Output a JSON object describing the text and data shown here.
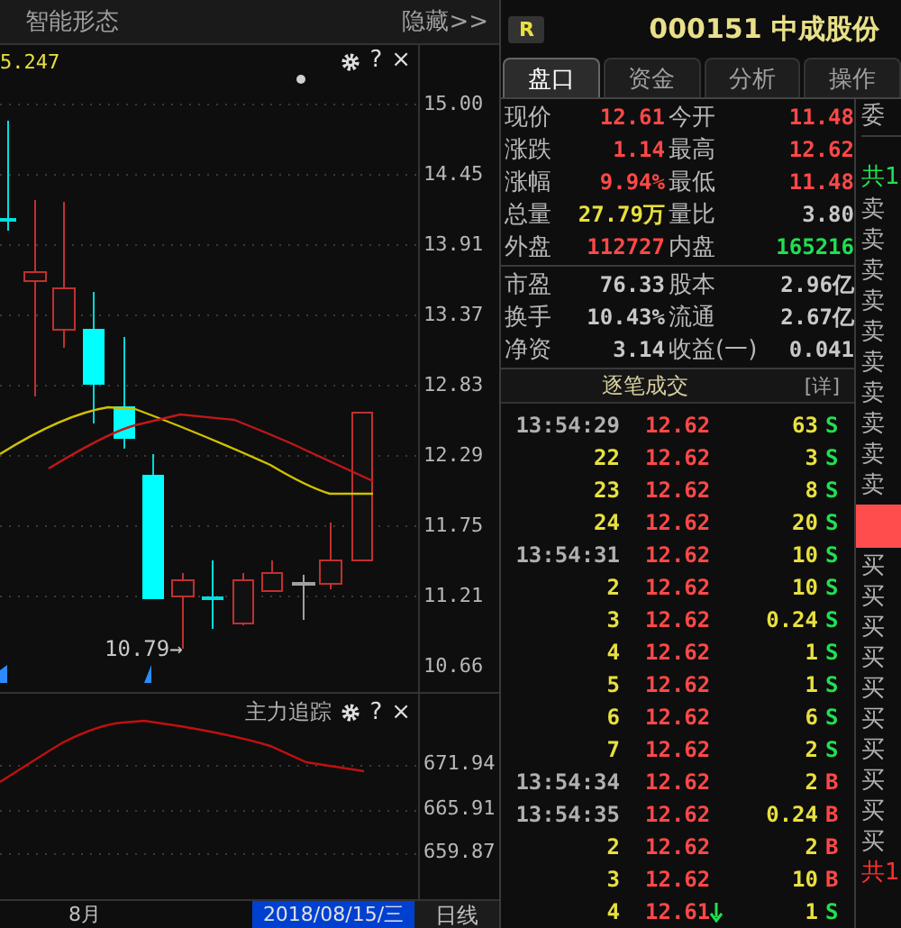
{
  "left_panel": {
    "title": "智能形态",
    "hide_button": "隐藏>>"
  },
  "main_chart": {
    "indicator_value": "5.247",
    "help": "?",
    "close": "×",
    "price_axis": [
      "15.00",
      "14.45",
      "13.91",
      "13.37",
      "12.83",
      "12.29",
      "11.75",
      "11.21",
      "10.66"
    ],
    "low_label": "10.79→"
  },
  "sub_chart": {
    "title": "主力追踪",
    "help": "?",
    "close": "×",
    "axis": [
      "671.94",
      "665.91",
      "659.87"
    ]
  },
  "bottom_bar": {
    "month": "8月",
    "cursor_date": "2018/08/15/三",
    "period": "日线"
  },
  "stock": {
    "badge": "R",
    "code_name": "000151 中成股份"
  },
  "tabs": [
    {
      "label": "盘口",
      "selected": true
    },
    {
      "label": "资金",
      "selected": false
    },
    {
      "label": "分析",
      "selected": false
    },
    {
      "label": "操作",
      "selected": false
    }
  ],
  "quote_groups": [
    [
      {
        "cells": [
          {
            "label": "现价",
            "value": "12.61",
            "kind": "up"
          },
          {
            "label": "今开",
            "value": "11.48",
            "kind": "up"
          }
        ]
      },
      {
        "cells": [
          {
            "label": "涨跌",
            "value": "1.14",
            "kind": "up"
          },
          {
            "label": "最高",
            "value": "12.62",
            "kind": "up"
          }
        ]
      },
      {
        "cells": [
          {
            "label": "涨幅",
            "value": "9.94%",
            "kind": "up"
          },
          {
            "label": "最低",
            "value": "11.48",
            "kind": "up"
          }
        ]
      },
      {
        "cells": [
          {
            "label": "总量",
            "value": "27.79万",
            "kind": "volume"
          },
          {
            "label": "量比",
            "value": "3.80",
            "kind": "flat"
          }
        ]
      },
      {
        "cells": [
          {
            "label": "外盘",
            "value": "112727",
            "kind": "up"
          },
          {
            "label": "内盘",
            "value": "165216",
            "kind": "down"
          }
        ]
      }
    ],
    [
      {
        "cells": [
          {
            "label": "市盈",
            "value": "76.33",
            "kind": "flat"
          },
          {
            "label": "股本",
            "value": "2.96亿",
            "kind": "flat"
          }
        ]
      },
      {
        "cells": [
          {
            "label": "换手",
            "value": "10.43%",
            "kind": "flat"
          },
          {
            "label": "流通",
            "value": "2.67亿",
            "kind": "flat"
          }
        ]
      },
      {
        "cells": [
          {
            "label": "净资",
            "value": "3.14",
            "kind": "flat"
          },
          {
            "label": "收益(一)",
            "value": "0.041",
            "kind": "flat"
          }
        ]
      }
    ]
  ],
  "trades_header": {
    "title": "逐笔成交",
    "detail": "[详]"
  },
  "trades": [
    {
      "time": "13:54:29",
      "full_time": true,
      "price": "12.62",
      "down_tick": false,
      "volume": "63",
      "side": "S",
      "buy": false
    },
    {
      "time": "22",
      "full_time": false,
      "price": "12.62",
      "down_tick": false,
      "volume": "3",
      "side": "S",
      "buy": false
    },
    {
      "time": "23",
      "full_time": false,
      "price": "12.62",
      "down_tick": false,
      "volume": "8",
      "side": "S",
      "buy": false
    },
    {
      "time": "24",
      "full_time": false,
      "price": "12.62",
      "down_tick": false,
      "volume": "20",
      "side": "S",
      "buy": false
    },
    {
      "time": "13:54:31",
      "full_time": true,
      "price": "12.62",
      "down_tick": false,
      "volume": "10",
      "side": "S",
      "buy": false
    },
    {
      "time": "2",
      "full_time": false,
      "price": "12.62",
      "down_tick": false,
      "volume": "10",
      "side": "S",
      "buy": false
    },
    {
      "time": "3",
      "full_time": false,
      "price": "12.62",
      "down_tick": false,
      "volume": "0.24",
      "side": "S",
      "buy": false
    },
    {
      "time": "4",
      "full_time": false,
      "price": "12.62",
      "down_tick": false,
      "volume": "1",
      "side": "S",
      "buy": false
    },
    {
      "time": "5",
      "full_time": false,
      "price": "12.62",
      "down_tick": false,
      "volume": "1",
      "side": "S",
      "buy": false
    },
    {
      "time": "6",
      "full_time": false,
      "price": "12.62",
      "down_tick": false,
      "volume": "6",
      "side": "S",
      "buy": false
    },
    {
      "time": "7",
      "full_time": false,
      "price": "12.62",
      "down_tick": false,
      "volume": "2",
      "side": "S",
      "buy": false
    },
    {
      "time": "13:54:34",
      "full_time": true,
      "price": "12.62",
      "down_tick": false,
      "volume": "2",
      "side": "B",
      "buy": true
    },
    {
      "time": "13:54:35",
      "full_time": true,
      "price": "12.62",
      "down_tick": false,
      "volume": "0.24",
      "side": "B",
      "buy": true
    },
    {
      "time": "2",
      "full_time": false,
      "price": "12.62",
      "down_tick": false,
      "volume": "2",
      "side": "B",
      "buy": true
    },
    {
      "time": "3",
      "full_time": false,
      "price": "12.62",
      "down_tick": false,
      "volume": "10",
      "side": "B",
      "buy": true
    },
    {
      "time": "4",
      "full_time": false,
      "price": "12.61",
      "down_tick": true,
      "volume": "1",
      "side": "S",
      "buy": false
    }
  ],
  "order_book": {
    "header": "委",
    "sell_total": "共1",
    "sell_levels": [
      "卖",
      "卖",
      "卖",
      "卖",
      "卖",
      "卖",
      "卖",
      "卖",
      "卖",
      "卖"
    ],
    "buy_levels": [
      "买",
      "买",
      "买",
      "买",
      "买",
      "买",
      "买",
      "买",
      "买",
      "买"
    ],
    "buy_total": "共1"
  }
}
